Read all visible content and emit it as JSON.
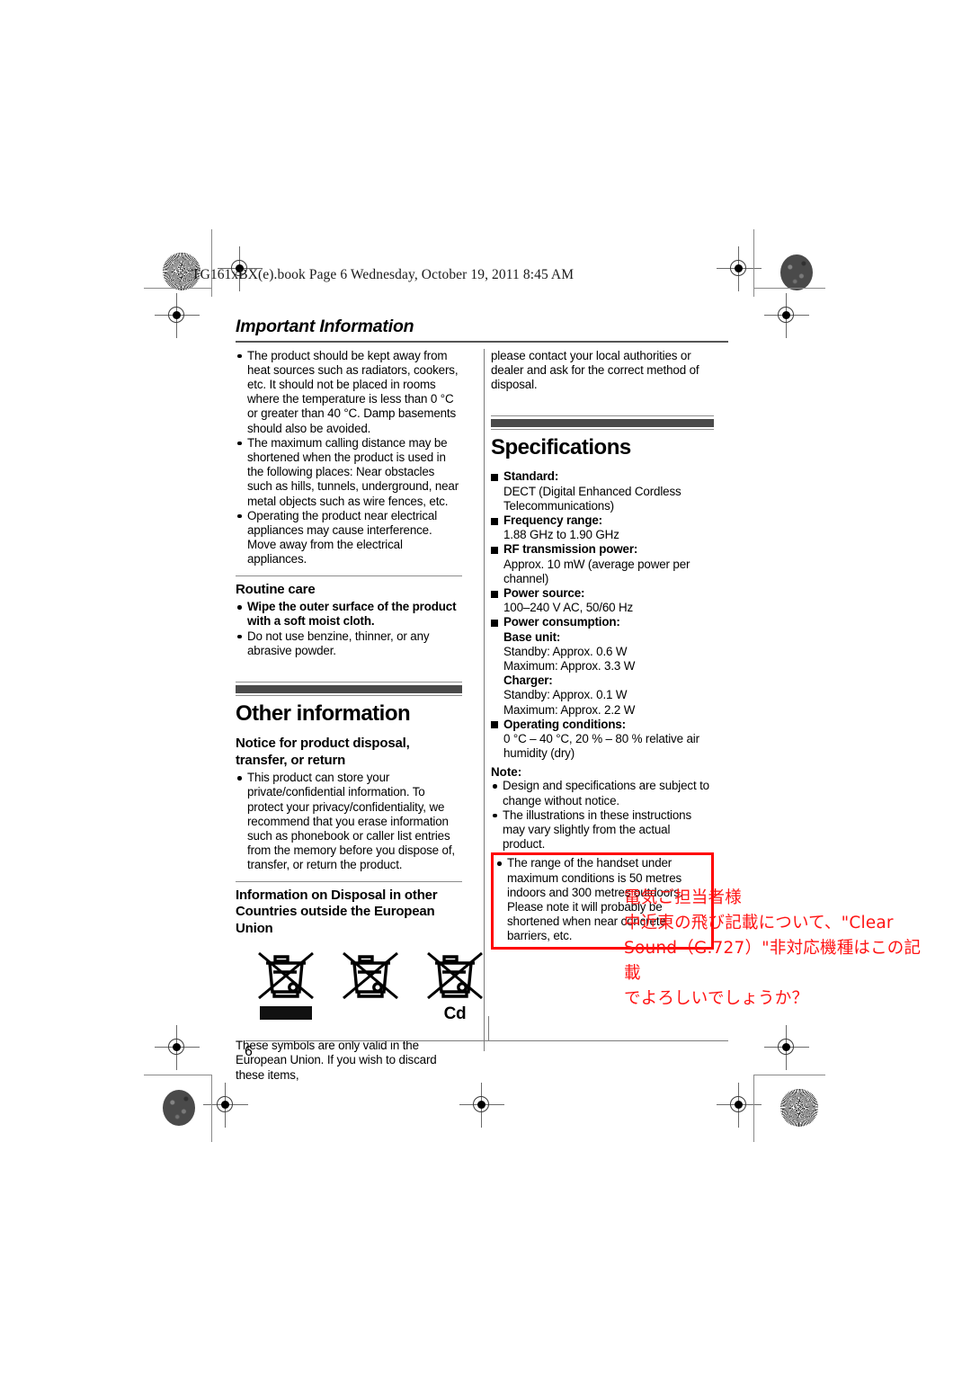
{
  "document": {
    "file_header": "TG161xBX(e).book  Page 6  Wednesday, October 19, 2011  8:45 AM",
    "running_head": "Important Information",
    "page_number": "6"
  },
  "left_column": {
    "intro_bullets": [
      "The product should be kept away from heat sources such as radiators, cookers, etc. It should not be placed in rooms where the temperature is less than 0 °C or greater than 40 °C. Damp basements should also be avoided.",
      "The maximum calling distance may be shortened when the product is used in the following places: Near obstacles such as hills, tunnels, underground, near metal objects such as wire fences, etc.",
      "Operating the product near electrical appliances may cause interference. Move away from the electrical appliances."
    ],
    "routine_care": {
      "heading": "Routine care",
      "bullets": [
        "Wipe the outer surface of the product with a soft moist cloth.",
        "Do not use benzine, thinner, or any abrasive powder."
      ]
    },
    "chapter": {
      "title": "Other information"
    },
    "disposal_notice": {
      "heading": "Notice for product disposal, transfer, or return",
      "bullets": [
        "This product can store your private/confidential information. To protect your privacy/confidentiality, we recommend that you erase information such as phonebook or caller list entries from the memory before you dispose of, transfer, or return the product."
      ]
    },
    "disposal_other_countries": {
      "heading": "Information on Disposal in other Countries outside the European Union",
      "symbols": [
        {
          "name": "crossed-out-wheelie-bin-with-bar",
          "label": ""
        },
        {
          "name": "crossed-out-wheelie-bin",
          "label": ""
        },
        {
          "name": "crossed-out-wheelie-bin-cadmium",
          "label": "Cd"
        }
      ],
      "tail_text": "These symbols are only valid in the European Union. If you wish to discard these items,"
    }
  },
  "right_column": {
    "continuation_text": "please contact your local authorities or dealer and ask for the correct method of disposal.",
    "specifications": {
      "title": "Specifications",
      "items": [
        {
          "term": "Standard:",
          "value": "DECT (Digital Enhanced Cordless Telecommunications)"
        },
        {
          "term": "Frequency range:",
          "value": "1.88 GHz to 1.90 GHz"
        },
        {
          "term": "RF transmission power:",
          "value": "Approx. 10 mW (average power per channel)"
        },
        {
          "term": "Power source:",
          "value": "100–240 V AC, 50/60 Hz"
        },
        {
          "term": "Power consumption:",
          "subgroups": [
            {
              "subterm": "Base unit:",
              "lines": [
                "Standby: Approx. 0.6 W",
                "Maximum: Approx. 3.3 W"
              ]
            },
            {
              "subterm": "Charger:",
              "lines": [
                "Standby: Approx. 0.1 W",
                "Maximum: Approx. 2.2 W"
              ]
            }
          ]
        },
        {
          "term": "Operating conditions:",
          "value": "0 °C – 40 °C, 20 % – 80 % relative air humidity (dry)"
        }
      ]
    },
    "note": {
      "label": "Note:",
      "bullets": [
        "Design and specifications are subject to change without notice.",
        "The illustrations in these instructions may vary slightly from the actual product."
      ],
      "highlighted_bullet": "The range of the handset under maximum conditions is 50 metres indoors and 300 metres outdoors. Please note it will probably be shortened when near concrete barriers, etc."
    }
  },
  "annotation": {
    "lines": [
      "電気ご担当者様",
      "中近東の飛び記載について、\"Clear",
      "Sound（G.727）\"非対応機種はこの記載",
      "でよろしいでしょうか？"
    ],
    "color": "#ff1414"
  },
  "colors": {
    "highlight_box": "#ff0000",
    "chapter_band": "#4a4a4a",
    "rule": "#8c8c8c"
  }
}
